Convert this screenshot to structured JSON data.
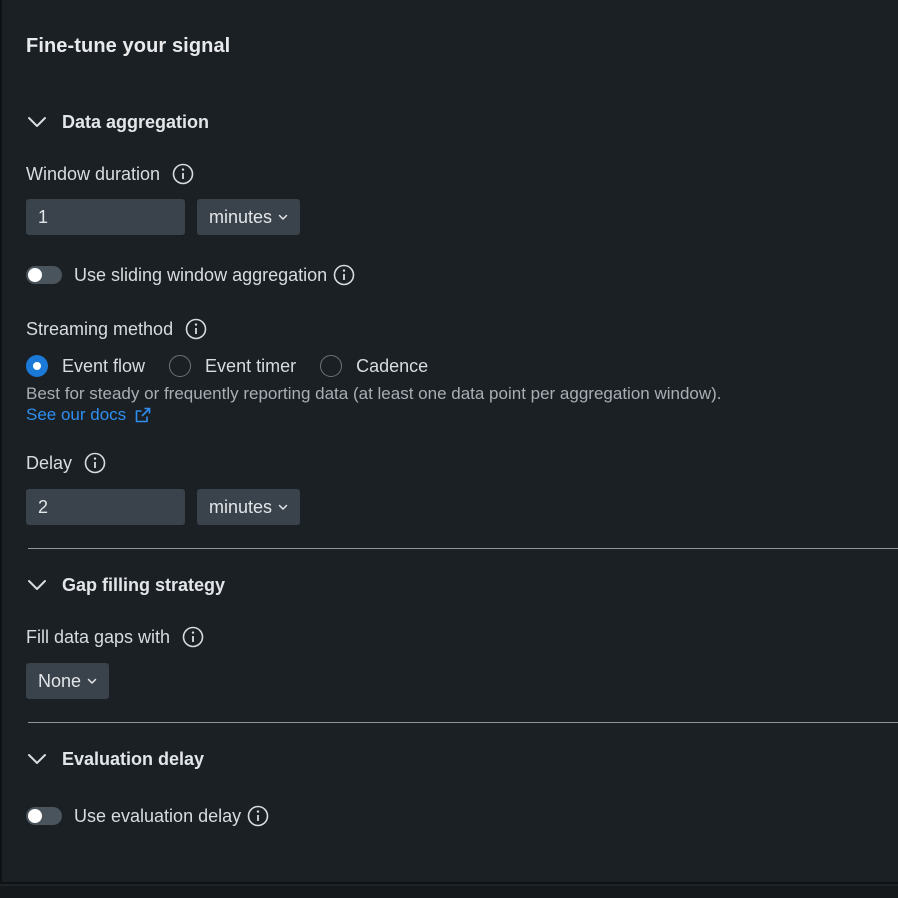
{
  "panel": {
    "title": "Fine-tune your signal"
  },
  "sections": {
    "data_aggregation": {
      "label": "Data aggregation",
      "window_duration": {
        "label": "Window duration",
        "value": "1",
        "unit": "minutes"
      },
      "sliding_window": {
        "label": "Use sliding window aggregation",
        "enabled": false
      },
      "streaming_method": {
        "label": "Streaming method",
        "options": [
          "Event flow",
          "Event timer",
          "Cadence"
        ],
        "selected": "Event flow",
        "help": "Best for steady or frequently reporting data (at least one data point per aggregation window).",
        "docs_link": "See our docs"
      },
      "delay": {
        "label": "Delay",
        "value": "2",
        "unit": "minutes"
      }
    },
    "gap_filling": {
      "label": "Gap filling strategy",
      "fill_label": "Fill data gaps with",
      "fill_value": "None"
    },
    "evaluation_delay": {
      "label": "Evaluation delay",
      "toggle_label": "Use evaluation delay",
      "enabled": false
    }
  },
  "colors": {
    "background": "#1b2025",
    "input_bg": "#3a434b",
    "accent": "#1b7ad8",
    "link": "#2f8eef"
  },
  "icons": {
    "section_chevron": "chevron-down-icon",
    "info": "info-icon",
    "select_caret": "caret-down-icon",
    "external_link": "external-link-icon"
  }
}
